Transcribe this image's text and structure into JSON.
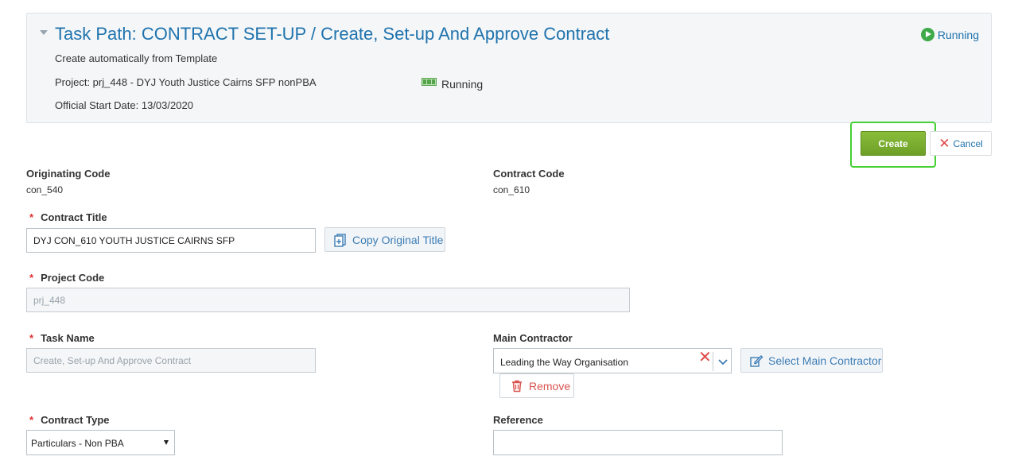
{
  "header": {
    "task_path": "Task Path: CONTRACT SET-UP / Create, Set-up And Approve Contract",
    "status_label": "Running",
    "subtitle": "Create automatically from Template",
    "project_line": "Project: prj_448 - DYJ Youth Justice Cairns SFP nonPBA",
    "project_status": "Running",
    "start_date_line": "Official Start Date: 13/03/2020"
  },
  "actions": {
    "create_label": "Create",
    "cancel_label": "Cancel"
  },
  "form": {
    "originating_code": {
      "label": "Originating Code",
      "value": "con_540"
    },
    "contract_code": {
      "label": "Contract Code",
      "value": "con_610"
    },
    "contract_title": {
      "label": "Contract Title",
      "value": "DYJ CON_610 YOUTH JUSTICE CAIRNS SFP",
      "copy_label": "Copy Original Title"
    },
    "project_code": {
      "label": "Project Code",
      "value": "prj_448"
    },
    "task_name": {
      "label": "Task Name",
      "value": "Create, Set-up And Approve Contract"
    },
    "main_contractor": {
      "label": "Main Contractor",
      "value": "Leading the Way Organisation",
      "select_label": "Select Main Contractor",
      "remove_label": "Remove"
    },
    "contract_type": {
      "label": "Contract Type",
      "value": "Particulars - Non PBA"
    },
    "reference": {
      "label": "Reference",
      "value": ""
    },
    "required_mark": "*"
  },
  "colors": {
    "link_blue": "#1f73ad",
    "create_green": "#6c9f25",
    "highlight_green": "#45d033",
    "required_red": "#e03030"
  }
}
